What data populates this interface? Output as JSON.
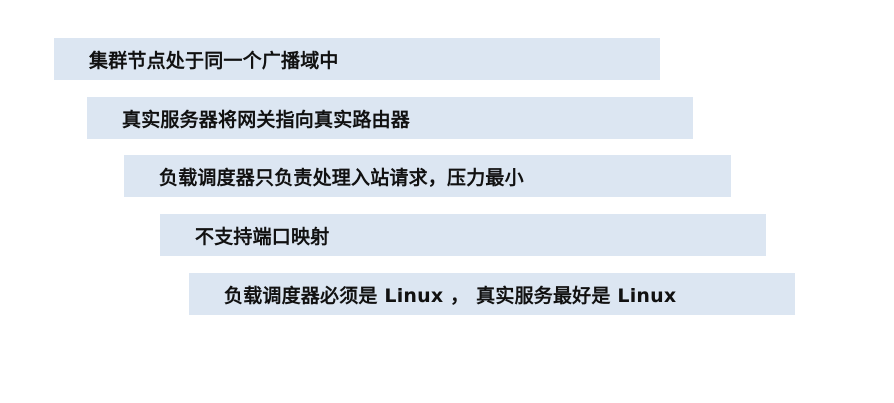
{
  "bars": [
    {
      "text": "集群节点处于同一个广播域中"
    },
    {
      "text": "真实服务器将网关指向真实路由器"
    },
    {
      "text": "负载调度器只负责处理入站请求，压力最小"
    },
    {
      "text": "不支持端口映射"
    },
    {
      "text": "负载调度器必须是 Linux ， 真实服务最好是 Linux"
    }
  ],
  "colors": {
    "bar_fill": "#dce6f2",
    "text": "#111111",
    "background": "#ffffff"
  }
}
